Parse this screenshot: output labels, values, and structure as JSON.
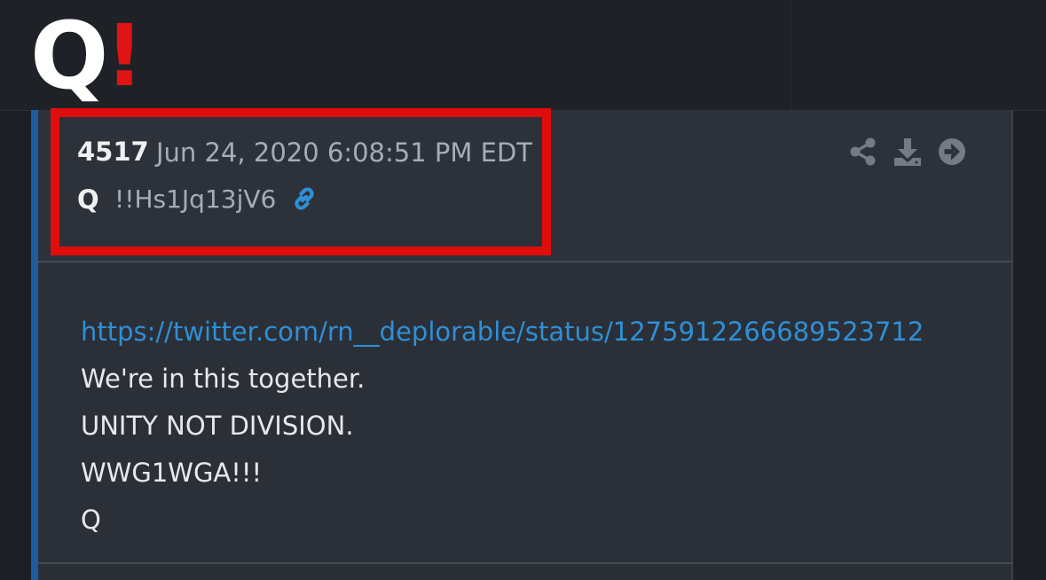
{
  "logo": {
    "letter": "Q",
    "exclaim": "!"
  },
  "post": {
    "number": "4517",
    "date": "Jun 24, 2020 6:08:51 PM EDT",
    "author": "Q",
    "tripcode": "!!Hs1Jq13jV6",
    "link_icon": "link-icon",
    "actions": [
      "share-icon",
      "download-icon",
      "forward-arrow-icon"
    ],
    "body": {
      "url": "https://twitter.com/rn__deplorable/status/1275912266689523712",
      "lines": [
        "We're in this together.",
        "UNITY NOT DIVISION.",
        "WWG1WGA!!!",
        "Q"
      ]
    }
  },
  "colors": {
    "highlight": "#e00d0d",
    "accent": "#1f5c9e",
    "link": "#2f8fd6",
    "logo_exclaim": "#e01414"
  }
}
